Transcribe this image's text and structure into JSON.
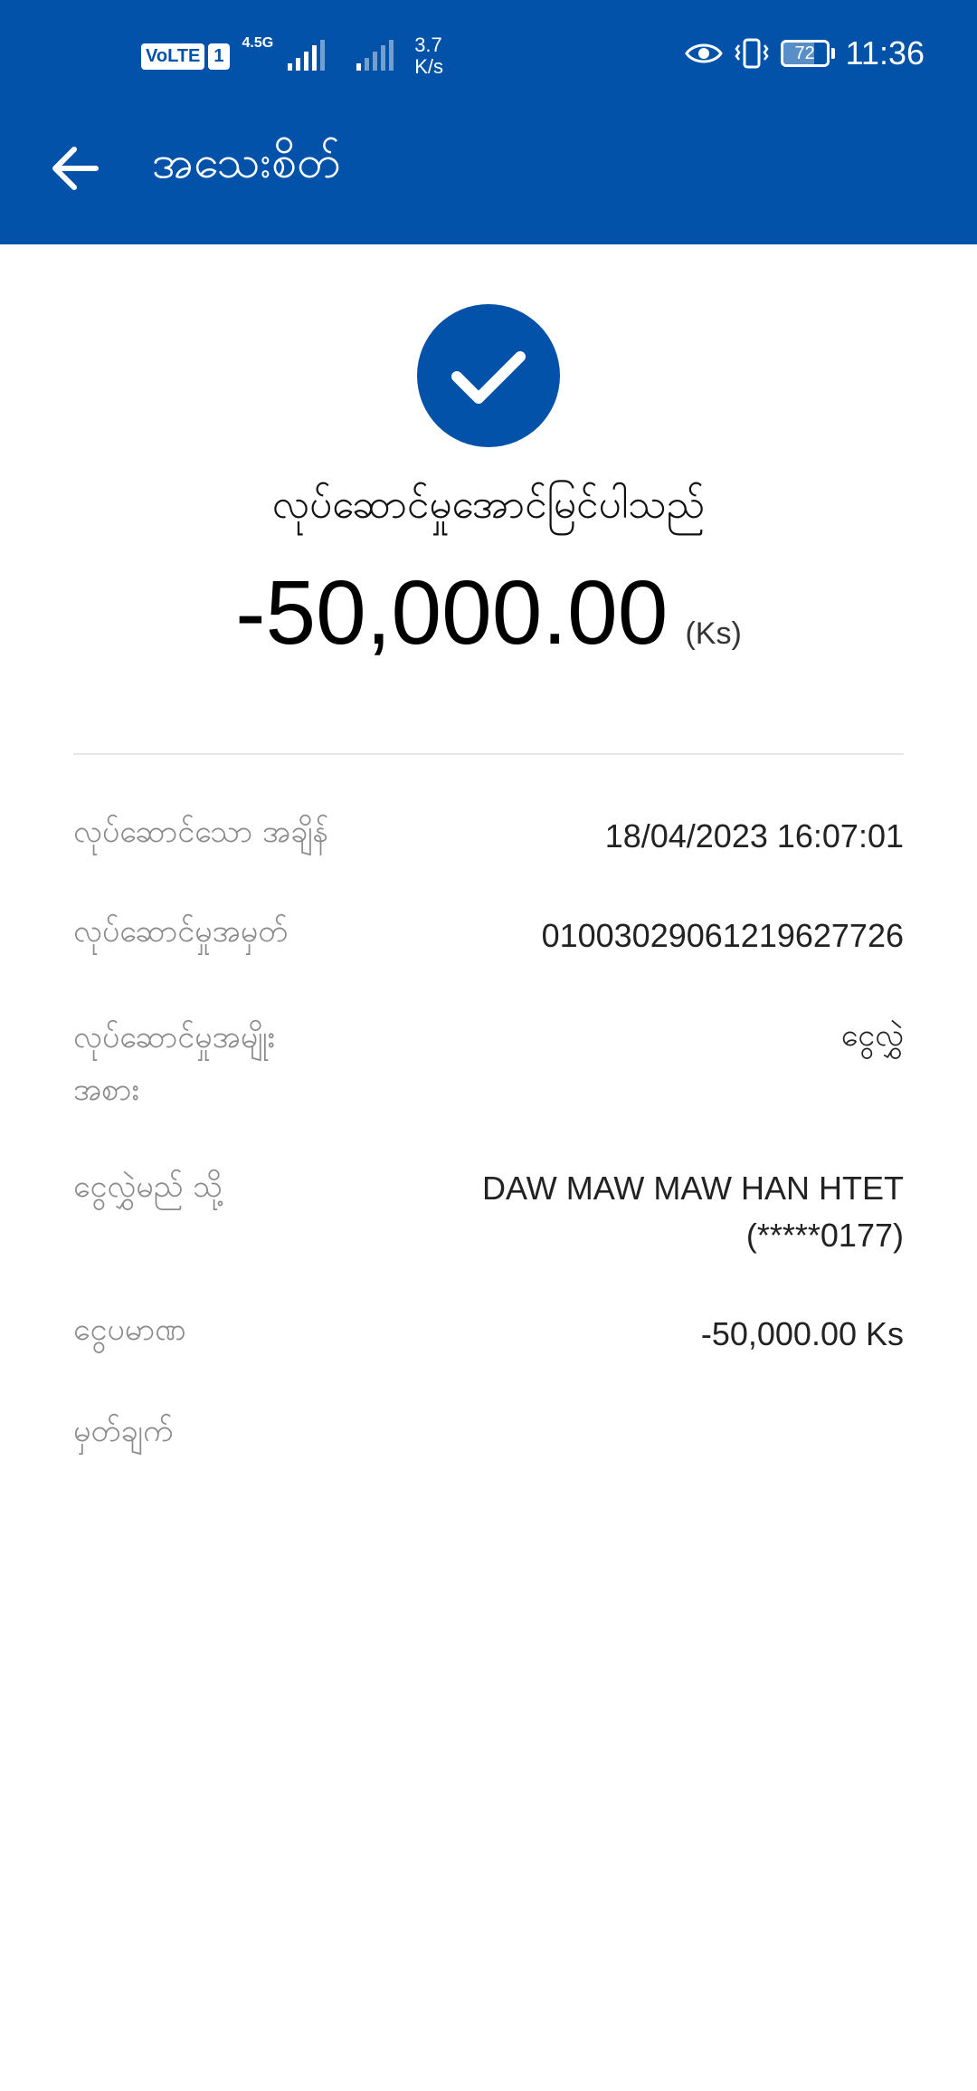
{
  "status_bar": {
    "volte": "VoLTE",
    "sim": "1",
    "network_type": "4.5G",
    "speed_value": "3.7",
    "speed_unit": "K/s",
    "battery": "72",
    "time": "11:36",
    "icons": [
      "eye-icon",
      "vibrate-icon",
      "battery-icon",
      "signal-icon"
    ]
  },
  "header": {
    "title": "အသေးစိတ်",
    "back_icon": "arrow-left-icon",
    "background_color": "#0152a8"
  },
  "result": {
    "icon": "check-icon",
    "status_text": "လုပ်ဆောင်မှုအောင်မြင်ပါသည်",
    "amount": "-50,000.00",
    "currency": "(Ks)"
  },
  "details": {
    "rows": [
      {
        "label": "လုပ်ဆောင်သော အချိန်",
        "value": "18/04/2023 16:07:01"
      },
      {
        "label": "လုပ်ဆောင်မှုအမှတ်",
        "value": "01003029061219627726"
      },
      {
        "label_line1": "လုပ်ဆောင်မှုအမျိုး",
        "label_line2": "အစား",
        "value": "ငွေလွှဲ"
      },
      {
        "label": "ငွေလွှဲမည် သို့",
        "value_line1": "DAW MAW MAW HAN HTET",
        "value_line2": "(*****0177)"
      },
      {
        "label": "ငွေပမာဏ",
        "value": "-50,000.00 Ks"
      },
      {
        "label": "မှတ်ချက်",
        "value": ""
      }
    ]
  }
}
